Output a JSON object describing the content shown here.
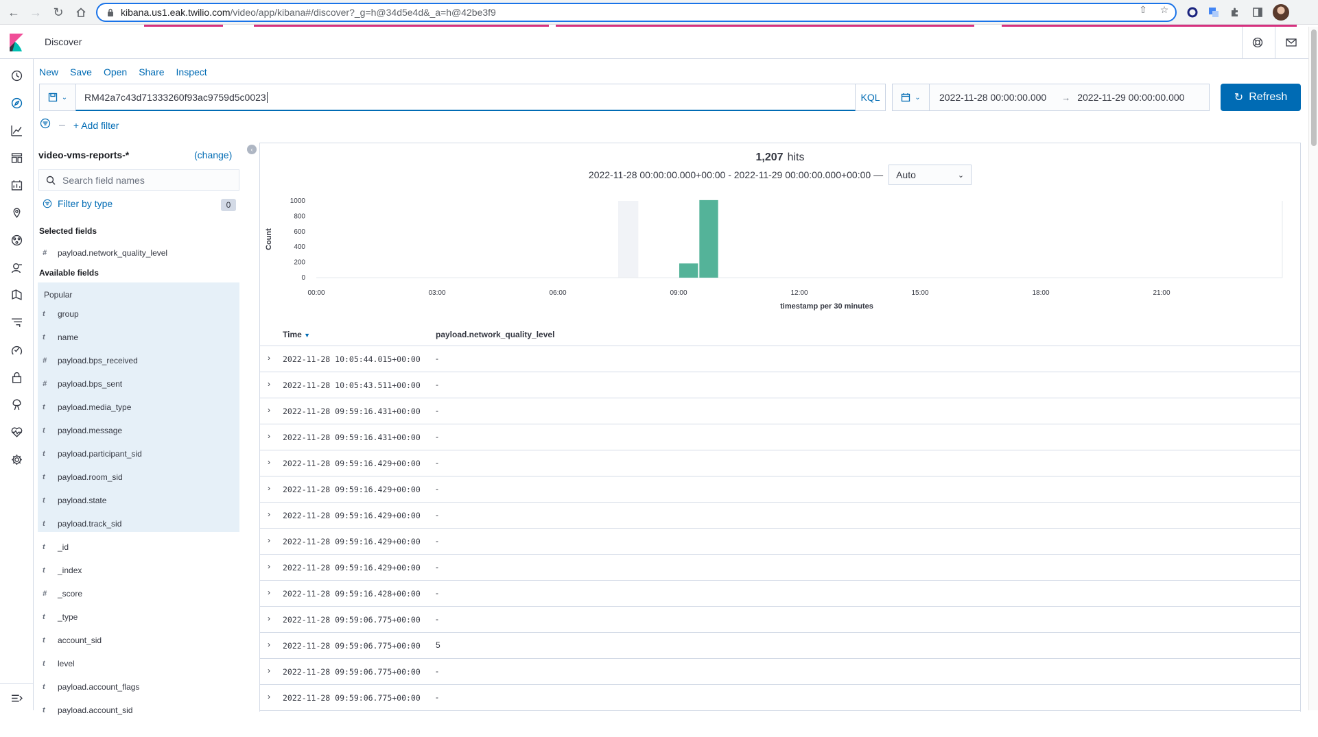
{
  "browser": {
    "url_host": "kibana.us1.eak.twilio.com",
    "url_path": "/video/app/kibana#/discover?_g=h@34d5e4d&_a=h@42be3f9"
  },
  "app": {
    "title": "Discover"
  },
  "top_menu": [
    "New",
    "Save",
    "Open",
    "Share",
    "Inspect"
  ],
  "query": {
    "value": "RM42a7c43d71333260f93ac9759d5c0023",
    "language": "KQL",
    "start": "2022-11-28 00:00:00.000",
    "end": "2022-11-29 00:00:00.000",
    "refresh_label": "Refresh"
  },
  "filters": {
    "add_label": "+ Add filter"
  },
  "sidebar": {
    "index_pattern": "video-vms-reports-*",
    "change_label": "(change)",
    "search_placeholder": "Search field names",
    "filter_by_type": "Filter by type",
    "filter_count": "0",
    "selected_title": "Selected fields",
    "selected": [
      {
        "type": "#",
        "name": "payload.network_quality_level"
      }
    ],
    "available_title": "Available fields",
    "popular_label": "Popular",
    "popular": [
      {
        "type": "t",
        "name": "group"
      },
      {
        "type": "t",
        "name": "name"
      },
      {
        "type": "#",
        "name": "payload.bps_received"
      },
      {
        "type": "#",
        "name": "payload.bps_sent"
      },
      {
        "type": "t",
        "name": "payload.media_type"
      },
      {
        "type": "t",
        "name": "payload.message"
      },
      {
        "type": "t",
        "name": "payload.participant_sid"
      },
      {
        "type": "t",
        "name": "payload.room_sid"
      },
      {
        "type": "t",
        "name": "payload.state"
      },
      {
        "type": "t",
        "name": "payload.track_sid"
      }
    ],
    "others": [
      {
        "type": "t",
        "name": "_id"
      },
      {
        "type": "t",
        "name": "_index"
      },
      {
        "type": "#",
        "name": "_score"
      },
      {
        "type": "t",
        "name": "_type"
      },
      {
        "type": "t",
        "name": "account_sid"
      },
      {
        "type": "t",
        "name": "level"
      },
      {
        "type": "t",
        "name": "payload.account_flags"
      },
      {
        "type": "t",
        "name": "payload.account_sid"
      }
    ]
  },
  "results": {
    "hits_count": "1,207",
    "hits_label": "hits",
    "range_text": "2022-11-28 00:00:00.000+00:00 - 2022-11-29 00:00:00.000+00:00 —",
    "interval": "Auto",
    "columns": [
      "Time",
      "payload.network_quality_level"
    ],
    "rows": [
      {
        "time": "2022-11-28 10:05:44.015+00:00",
        "value": "-"
      },
      {
        "time": "2022-11-28 10:05:43.511+00:00",
        "value": "-"
      },
      {
        "time": "2022-11-28 09:59:16.431+00:00",
        "value": "-"
      },
      {
        "time": "2022-11-28 09:59:16.431+00:00",
        "value": "-"
      },
      {
        "time": "2022-11-28 09:59:16.429+00:00",
        "value": "-"
      },
      {
        "time": "2022-11-28 09:59:16.429+00:00",
        "value": "-"
      },
      {
        "time": "2022-11-28 09:59:16.429+00:00",
        "value": "-"
      },
      {
        "time": "2022-11-28 09:59:16.429+00:00",
        "value": "-"
      },
      {
        "time": "2022-11-28 09:59:16.429+00:00",
        "value": "-"
      },
      {
        "time": "2022-11-28 09:59:16.428+00:00",
        "value": "-"
      },
      {
        "time": "2022-11-28 09:59:06.775+00:00",
        "value": "-"
      },
      {
        "time": "2022-11-28 09:59:06.775+00:00",
        "value": "5"
      },
      {
        "time": "2022-11-28 09:59:06.775+00:00",
        "value": "-"
      },
      {
        "time": "2022-11-28 09:59:06.775+00:00",
        "value": "-"
      }
    ]
  },
  "chart_data": {
    "type": "bar",
    "xlabel": "timestamp per 30 minutes",
    "ylabel": "Count",
    "x_ticks": [
      "00:00",
      "03:00",
      "06:00",
      "09:00",
      "12:00",
      "15:00",
      "18:00",
      "21:00"
    ],
    "y_ticks": [
      0,
      200,
      400,
      600,
      800,
      1000
    ],
    "ylim": [
      0,
      1000
    ],
    "bar_color": "#54b399",
    "series": [
      {
        "x": [
          "09:00",
          "09:30"
        ],
        "values": [
          185,
          1010
        ]
      }
    ]
  }
}
